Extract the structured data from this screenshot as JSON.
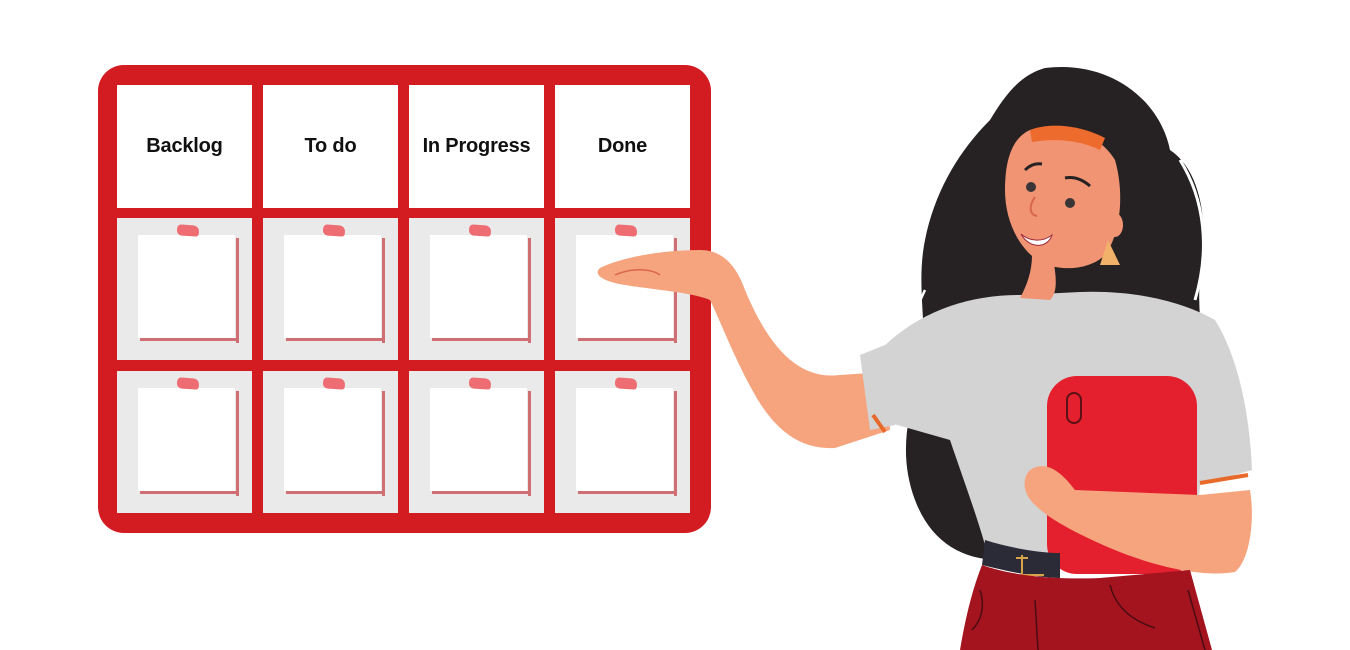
{
  "board": {
    "columns": [
      {
        "label": "Backlog"
      },
      {
        "label": "To do"
      },
      {
        "label": "In Progress"
      },
      {
        "label": "Done"
      }
    ],
    "rows": 2,
    "notes_per_column": 2
  },
  "illustration": {
    "subject": "woman-presenting-board",
    "holding": "red-tablet"
  },
  "colors": {
    "board_red": "#d31b22",
    "slot_gray": "#eaeaeb",
    "tape_pink": "#ee6d73",
    "note_shadow": "#cf6f74",
    "hair": "#262223",
    "skin": "#f4a07a",
    "shirt": "#d3d3d3",
    "tablet": "#e5202e",
    "pants": "#a3141f"
  }
}
